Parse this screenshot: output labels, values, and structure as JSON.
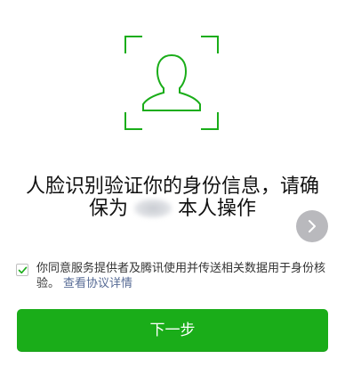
{
  "colors": {
    "accent": "#1aad19",
    "link": "#576b95",
    "frame": "#1aad19"
  },
  "icons": {
    "face": "person-silhouette-icon",
    "arrow": "chevron-right-icon",
    "check": "checkmark-icon"
  },
  "headline": {
    "line1": "人脸识别验证你的身份信息，请确",
    "line2_prefix": "保为",
    "line2_suffix": "本人操作"
  },
  "agreement": {
    "checked": true,
    "text": "你同意服务提供者及腾讯使用并传送相关数据用于身份核验。",
    "link_label": "查看协议详情"
  },
  "next_button": {
    "label": "下一步"
  }
}
